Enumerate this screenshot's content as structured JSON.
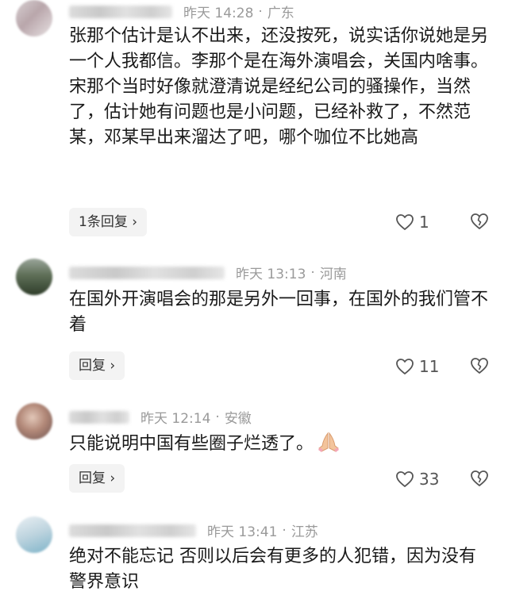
{
  "comments": [
    {
      "time": "昨天 14:28",
      "location": "广东",
      "text": "张那个估计是认不出来，还没按死，说实话你说她是另一个人我都信。李那个是在海外演唱会，关国内啥事。宋那个当时好像就澄清说是经纪公司的骚操作，当然了，估计她有问题也是小问题，已经补救了，不然范某，邓某早出来溜达了吧，哪个咖位不比她高",
      "reply_label": "1条回复 ›",
      "likes": "1"
    },
    {
      "time": "昨天 13:13",
      "location": "河南",
      "text": "在国外开演唱会的那是另外一回事，在国外的我们管不着",
      "reply_label": "回复 ›",
      "likes": "11"
    },
    {
      "time": "昨天 12:14",
      "location": "安徽",
      "text": "只能说明中国有些圈子烂透了。",
      "reply_label": "回复 ›",
      "likes": "33"
    },
    {
      "time": "昨天 13:41",
      "location": "江苏",
      "text": "绝对不能忘记 否则以后会有更多的人犯错，因为没有警界意识",
      "reply_label": "",
      "likes": ""
    }
  ],
  "separator": "·",
  "icons": {
    "like": "heart-outline-icon",
    "dislike": "broken-heart-icon",
    "emoji": "folded-hands-emoji"
  },
  "colors": {
    "meta": "#9a9a9a",
    "text": "#1a1a1a",
    "reply_bg": "#f3f3f3"
  }
}
